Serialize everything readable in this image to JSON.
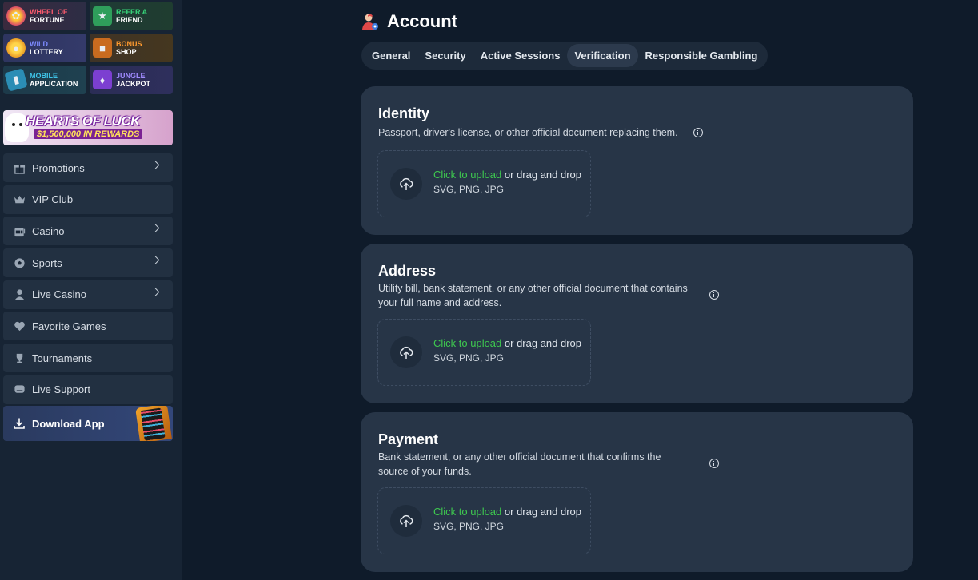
{
  "sidebar": {
    "promos": [
      {
        "line1": "WHEEL OF",
        "line2": "FORTUNE",
        "icon": "wheel-icon"
      },
      {
        "line1": "REFER A",
        "line2": "FRIEND",
        "icon": "megaphone-icon"
      },
      {
        "line1": "WILD",
        "line2": "LOTTERY",
        "icon": "cat-lottery-icon"
      },
      {
        "line1": "BONUS",
        "line2": "SHOP",
        "icon": "shop-icon"
      },
      {
        "line1": "MOBILE",
        "line2": "APPLICATION",
        "icon": "phone-icon"
      },
      {
        "line1": "JUNGLE",
        "line2": "JACKPOT",
        "icon": "jackpot-icon"
      }
    ],
    "banner": {
      "title": "HEARTS OF LUCK",
      "subtitle": "$1,500,000 IN REWARDS"
    },
    "nav": [
      {
        "label": "Promotions",
        "icon": "gift-icon",
        "has_chevron": true
      },
      {
        "label": "VIP Club",
        "icon": "crown-icon",
        "has_chevron": false
      },
      {
        "label": "Casino",
        "icon": "slot-machine-icon",
        "has_chevron": true
      },
      {
        "label": "Sports",
        "icon": "ball-icon",
        "has_chevron": true
      },
      {
        "label": "Live Casino",
        "icon": "dealer-icon",
        "has_chevron": true
      },
      {
        "label": "Favorite Games",
        "icon": "heart-icon",
        "has_chevron": false
      },
      {
        "label": "Tournaments",
        "icon": "trophy-icon",
        "has_chevron": false
      },
      {
        "label": "Live Support",
        "icon": "chat-icon",
        "has_chevron": false
      }
    ],
    "download_label": "Download App"
  },
  "header": {
    "title": "Account",
    "icon": "account-icon"
  },
  "tabs": [
    {
      "label": "General",
      "active": false
    },
    {
      "label": "Security",
      "active": false
    },
    {
      "label": "Active Sessions",
      "active": false
    },
    {
      "label": "Verification",
      "active": true
    },
    {
      "label": "Responsible Gambling",
      "active": false
    }
  ],
  "cards": [
    {
      "title": "Identity",
      "description": "Passport, driver's license, or other official document replacing them.",
      "upload_link": "Click to upload",
      "upload_text": " or drag and drop",
      "formats": "SVG, PNG, JPG"
    },
    {
      "title": "Address",
      "description": "Utility bill, bank statement, or any other official document that contains your full name and address.",
      "upload_link": "Click to upload",
      "upload_text": " or drag and drop",
      "formats": "SVG, PNG, JPG"
    },
    {
      "title": "Payment",
      "description": "Bank statement, or any other official document that confirms the source of your funds.",
      "upload_link": "Click to upload",
      "upload_text": " or drag and drop",
      "formats": "SVG, PNG, JPG"
    }
  ],
  "colors": {
    "background": "#0f1b2a",
    "sidebar": "#172434",
    "card": "#273547",
    "accent_green": "#3ec94f"
  }
}
